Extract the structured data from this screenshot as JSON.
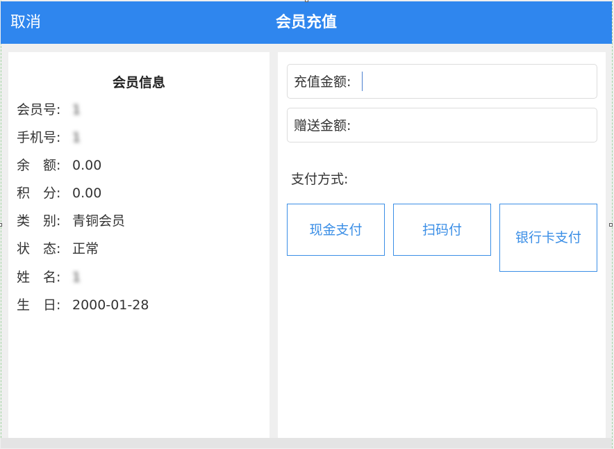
{
  "header": {
    "cancel_label": "取消",
    "title": "会员充值"
  },
  "member_info": {
    "title": "会员信息",
    "rows": [
      {
        "label": "会员号:",
        "value": "1",
        "obscured": true
      },
      {
        "label": "手机号:",
        "value": "1",
        "obscured": true
      },
      {
        "label": "余　额:",
        "value": "0.00"
      },
      {
        "label": "积　分:",
        "value": "0.00"
      },
      {
        "label": "类　别:",
        "value": "青铜会员"
      },
      {
        "label": "状　态:",
        "value": "正常"
      },
      {
        "label": "姓　名:",
        "value": "1",
        "obscured": true
      },
      {
        "label": "生　日:",
        "value": "2000-01-28"
      }
    ]
  },
  "recharge": {
    "amount_label": "充值金额:",
    "amount_value": "",
    "bonus_label": "赠送金额:",
    "bonus_value": ""
  },
  "payment": {
    "label": "支付方式:",
    "methods": [
      "现金支付",
      "扫码付",
      "银行卡支付"
    ]
  },
  "colors": {
    "header_bg": "#2f86ee",
    "accent": "#3a8ee6"
  }
}
